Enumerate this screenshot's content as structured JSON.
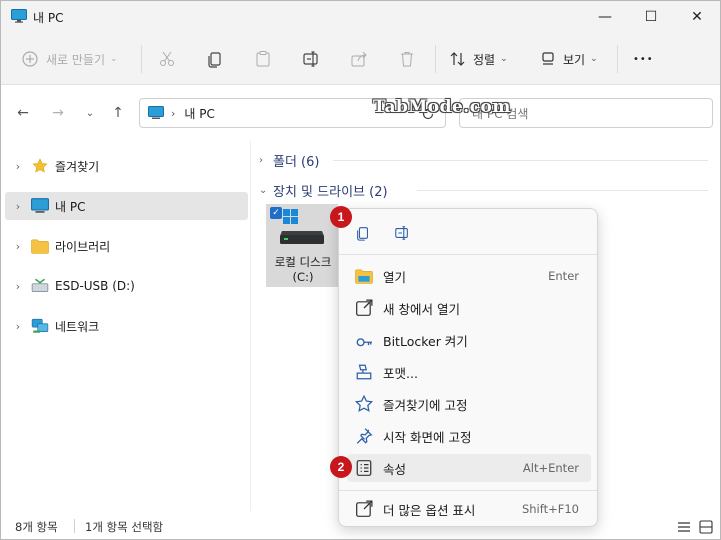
{
  "window": {
    "title": "내 PC",
    "minimize": "—",
    "maximize": "☐",
    "close": "✕"
  },
  "toolbar": {
    "new_label": "새로 만들기",
    "sort_label": "정렬",
    "view_label": "보기",
    "more": "•••"
  },
  "address": {
    "path": "내 PC",
    "search_placeholder": "내 PC 검색",
    "watermark": "TabMode.com"
  },
  "sidebar": {
    "items": [
      {
        "label": "즐겨찾기"
      },
      {
        "label": "내 PC"
      },
      {
        "label": "라이브러리"
      },
      {
        "label": "ESD-USB (D:)"
      },
      {
        "label": "네트워크"
      }
    ]
  },
  "content": {
    "folders_header": "폴더 (6)",
    "drives_header": "장치 및 드라이브 (2)",
    "drive_label": "로컬 디스크 (C:)"
  },
  "context_menu": {
    "items": [
      {
        "label": "열기",
        "shortcut": "Enter"
      },
      {
        "label": "새 창에서 열기",
        "shortcut": ""
      },
      {
        "label": "BitLocker 켜기",
        "shortcut": ""
      },
      {
        "label": "포맷...",
        "shortcut": ""
      },
      {
        "label": "즐겨찾기에 고정",
        "shortcut": ""
      },
      {
        "label": "시작 화면에 고정",
        "shortcut": ""
      },
      {
        "label": "속성",
        "shortcut": "Alt+Enter"
      },
      {
        "label": "더 많은 옵션 표시",
        "shortcut": "Shift+F10"
      }
    ]
  },
  "badges": {
    "one": "1",
    "two": "2"
  },
  "status": {
    "count": "8개 항목",
    "selected": "1개 항목 선택함"
  },
  "colors": {
    "accent": "#0067c0",
    "badge": "#c8161d",
    "header_text": "#2a3d74"
  }
}
